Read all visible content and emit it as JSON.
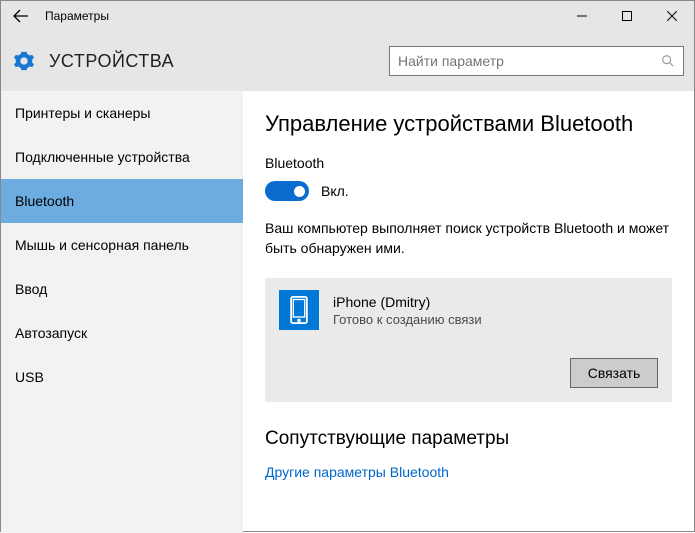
{
  "window": {
    "title": "Параметры"
  },
  "header": {
    "title": "УСТРОЙСТВА"
  },
  "search": {
    "placeholder": "Найти параметр"
  },
  "sidebar": {
    "items": [
      {
        "label": "Принтеры и сканеры"
      },
      {
        "label": "Подключенные устройства"
      },
      {
        "label": "Bluetooth",
        "selected": true
      },
      {
        "label": "Мышь и сенсорная панель"
      },
      {
        "label": "Ввод"
      },
      {
        "label": "Автозапуск"
      },
      {
        "label": "USB"
      }
    ]
  },
  "page": {
    "title": "Управление устройствами Bluetooth",
    "bt_label": "Bluetooth",
    "toggle_state": "Вкл.",
    "description": "Ваш компьютер выполняет поиск устройств Bluetooth и может быть обнаружен ими."
  },
  "device": {
    "name": "iPhone (Dmitry)",
    "status": "Готово к созданию связи",
    "pair_button": "Связать"
  },
  "related": {
    "heading": "Сопутствующие параметры",
    "link": "Другие параметры Bluetooth"
  }
}
